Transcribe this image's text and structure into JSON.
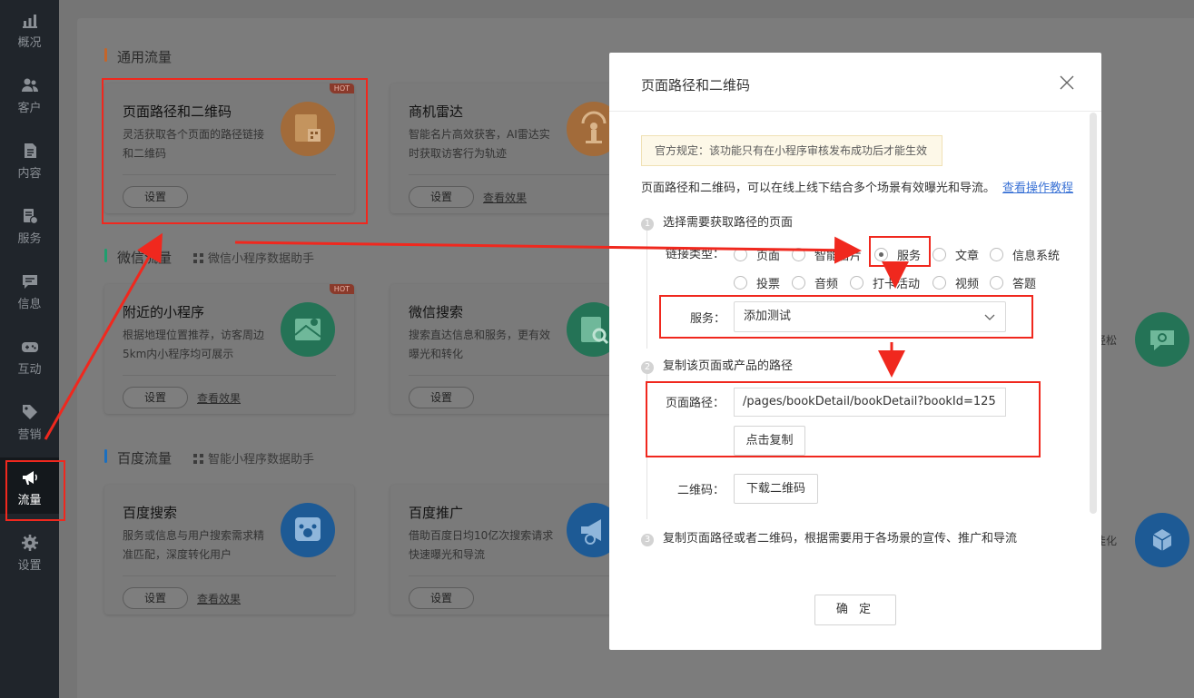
{
  "sidebar": {
    "items": [
      {
        "label": "概况",
        "icon": "chart-icon"
      },
      {
        "label": "客户",
        "icon": "users-icon"
      },
      {
        "label": "内容",
        "icon": "document-icon"
      },
      {
        "label": "服务",
        "icon": "service-icon"
      },
      {
        "label": "信息",
        "icon": "message-icon"
      },
      {
        "label": "互动",
        "icon": "gamepad-icon"
      },
      {
        "label": "营销",
        "icon": "tag-icon"
      },
      {
        "label": "流量",
        "icon": "megaphone-icon"
      },
      {
        "label": "设置",
        "icon": "gear-icon"
      }
    ],
    "active": "流量"
  },
  "sections": {
    "general": {
      "title": "通用流量"
    },
    "wechat": {
      "title": "微信流量",
      "sub": "微信小程序数据助手"
    },
    "baidu": {
      "title": "百度流量",
      "sub": "智能小程序数据助手"
    }
  },
  "cards": {
    "page_path": {
      "title": "页面路径和二维码",
      "desc": "灵活获取各个页面的路径链接和二维码",
      "btn": "设置",
      "badge": "HOT"
    },
    "radar": {
      "title": "商机雷达",
      "desc": "智能名片高效获客，AI雷达实时获取访客行为轨迹",
      "btn": "设置",
      "link": "查看效果"
    },
    "nearby": {
      "title": "附近的小程序",
      "desc": "根据地理位置推荐，访客周边5km内小程序均可展示",
      "btn": "设置",
      "link": "查看效果",
      "badge": "HOT"
    },
    "wx_search": {
      "title": "微信搜索",
      "desc": "搜索直达信息和服务，更有效曝光和转化",
      "btn": "设置"
    },
    "bd_search": {
      "title": "百度搜索",
      "desc": "服务或信息与用户搜索需求精准匹配，深度转化用户",
      "btn": "设置",
      "link": "查看效果"
    },
    "bd_promo": {
      "title": "百度推广",
      "desc": "借助百度日均10亿次搜索请求快速曝光和导流",
      "btn": "设置"
    }
  },
  "peek": {
    "text1": "轻松",
    "text2": "佳化"
  },
  "modal": {
    "title": "页面路径和二维码",
    "notice": "官方规定：该功能只有在小程序审核发布成功后才能生效",
    "intro": "页面路径和二维码，可以在线上线下结合多个场景有效曝光和导流。",
    "intro_link": "查看操作教程",
    "step1": {
      "num": "1",
      "text": "选择需要获取路径的页面"
    },
    "link_type_label": "链接类型：",
    "link_types": [
      "页面",
      "智能名片",
      "服务",
      "文章",
      "信息系统",
      "投票",
      "音频",
      "打卡活动",
      "视频",
      "答题"
    ],
    "selected_type": "服务",
    "service_label": "服务：",
    "service_value": "添加测试",
    "step2": {
      "num": "2",
      "text": "复制该页面或产品的路径"
    },
    "path_label": "页面路径：",
    "path_value": "/pages/bookDetail/bookDetail?bookId=125",
    "copy_btn": "点击复制",
    "qr_label": "二维码：",
    "qr_btn": "下载二维码",
    "step3": {
      "num": "3",
      "text": "复制页面路径或者二维码，根据需要用于各场景的宣传、推广和导流"
    },
    "ok_btn": "确 定"
  },
  "colors": {
    "annotation_red": "#f0281e",
    "link_blue": "#3d74d6",
    "orange": "#e0792a",
    "green": "#1f9e6e",
    "blue": "#1a6fc0"
  }
}
